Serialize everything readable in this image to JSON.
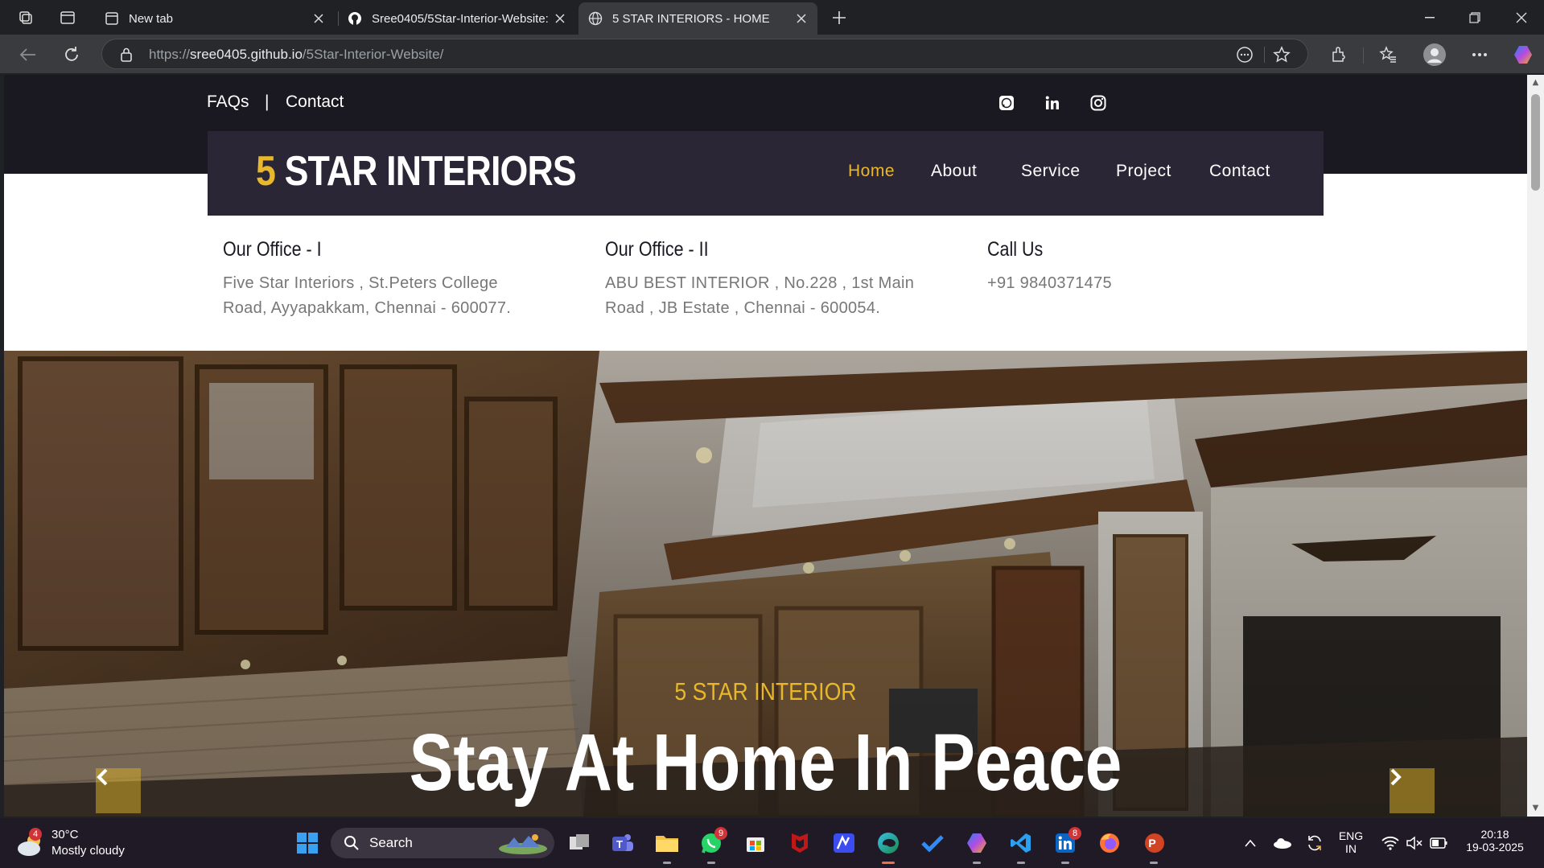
{
  "browser": {
    "tabs": [
      {
        "title": "New tab",
        "favicon": "new-tab-icon"
      },
      {
        "title": "Sree0405/5Star-Interior-Website:",
        "favicon": "github-icon"
      },
      {
        "title": "5 STAR INTERIORS - HOME",
        "favicon": "globe-icon",
        "active": true
      }
    ],
    "url_scheme": "https://",
    "url_host": "sree0405.github.io",
    "url_path": "/5Star-Interior-Website/"
  },
  "page": {
    "top_links": {
      "faqs": "FAQs",
      "separator": "|",
      "contact": "Contact"
    },
    "social": [
      "whatsapp-icon",
      "linkedin-icon",
      "instagram-icon"
    ],
    "brand": {
      "number": "5",
      "name": "STAR INTERIORS"
    },
    "nav": [
      "Home",
      "About",
      "Service",
      "Project",
      "Contact"
    ],
    "offices": [
      {
        "title": "Our Office - I",
        "line1": "Five Star Interiors , St.Peters College",
        "line2": "Road, Ayyapakkam, Chennai - 600077."
      },
      {
        "title": "Our Office - II",
        "line1": "ABU BEST INTERIOR , No.228 , 1st Main",
        "line2": "Road , JB Estate , Chennai - 600054."
      },
      {
        "title": "Call Us",
        "line1": "+91 9840371475",
        "line2": ""
      }
    ],
    "hero": {
      "kicker": "5 STAR INTERIOR",
      "title": "Stay At Home In Peace"
    }
  },
  "taskbar": {
    "weather": {
      "temp": "30°C",
      "desc": "Mostly cloudy",
      "badge": "4"
    },
    "search_label": "Search",
    "badges": {
      "whatsapp": "9",
      "linkedin": "8"
    },
    "lang_top": "ENG",
    "lang_bottom": "IN",
    "time": "20:18",
    "date": "19-03-2025"
  },
  "colors": {
    "accent": "#e8b82a",
    "dark": "#1a1820",
    "navbar": "#2a2635"
  }
}
